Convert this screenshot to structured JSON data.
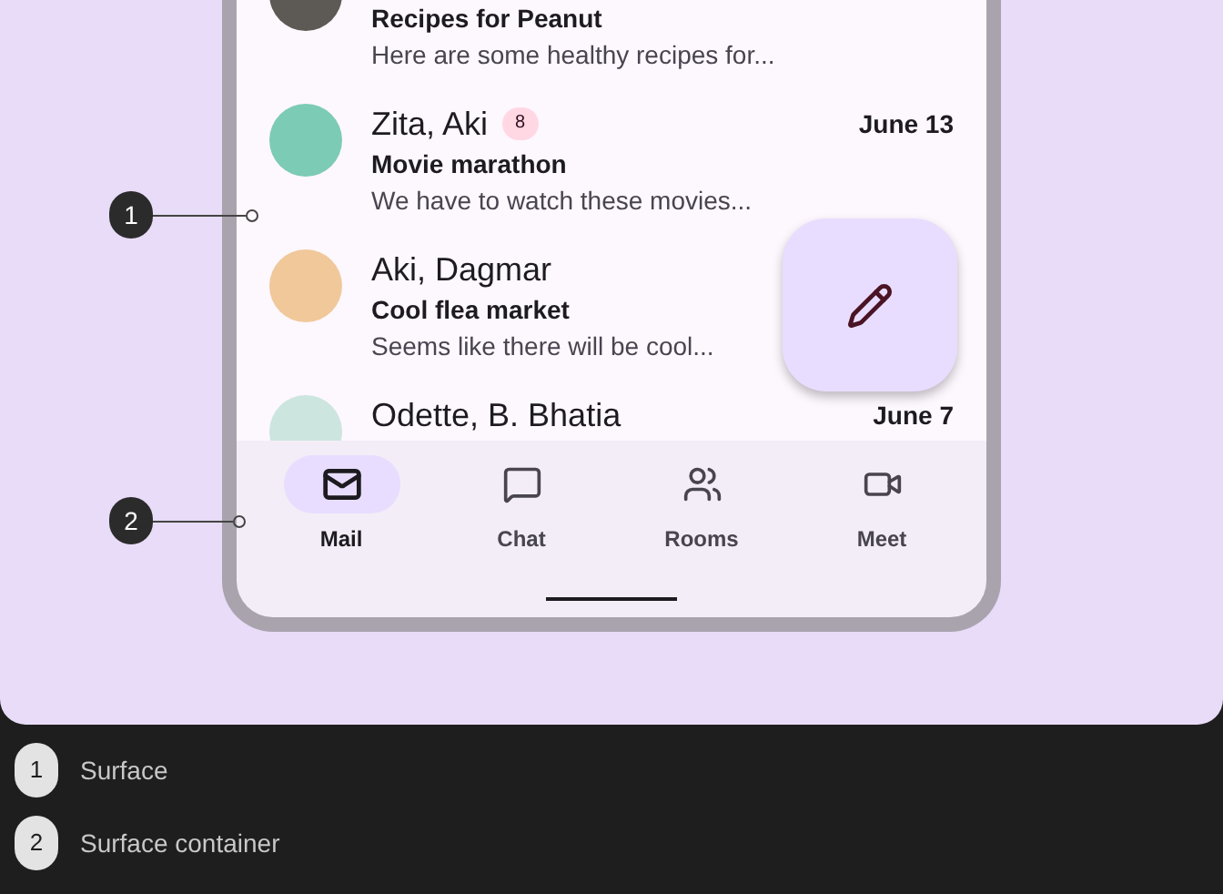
{
  "messages": [
    {
      "subject": "Recipes for Peanut",
      "preview": "Here are some healthy recipes for..."
    },
    {
      "name": "Zita, Aki",
      "badge": "8",
      "date": "June 13",
      "subject": "Movie marathon",
      "preview": "We have to watch these movies..."
    },
    {
      "name": "Aki, Dagmar",
      "subject": "Cool flea market",
      "preview": "Seems like there will be cool..."
    },
    {
      "name": "Odette, B. Bhatia",
      "date": "June 7"
    }
  ],
  "navigation": [
    {
      "label": "Mail",
      "selected": true
    },
    {
      "label": "Chat",
      "selected": false
    },
    {
      "label": "Rooms",
      "selected": false
    },
    {
      "label": "Meet",
      "selected": false
    }
  ],
  "callouts": [
    "1",
    "2"
  ],
  "legend": [
    {
      "number": "1",
      "label": "Surface"
    },
    {
      "number": "2",
      "label": "Surface container"
    }
  ]
}
